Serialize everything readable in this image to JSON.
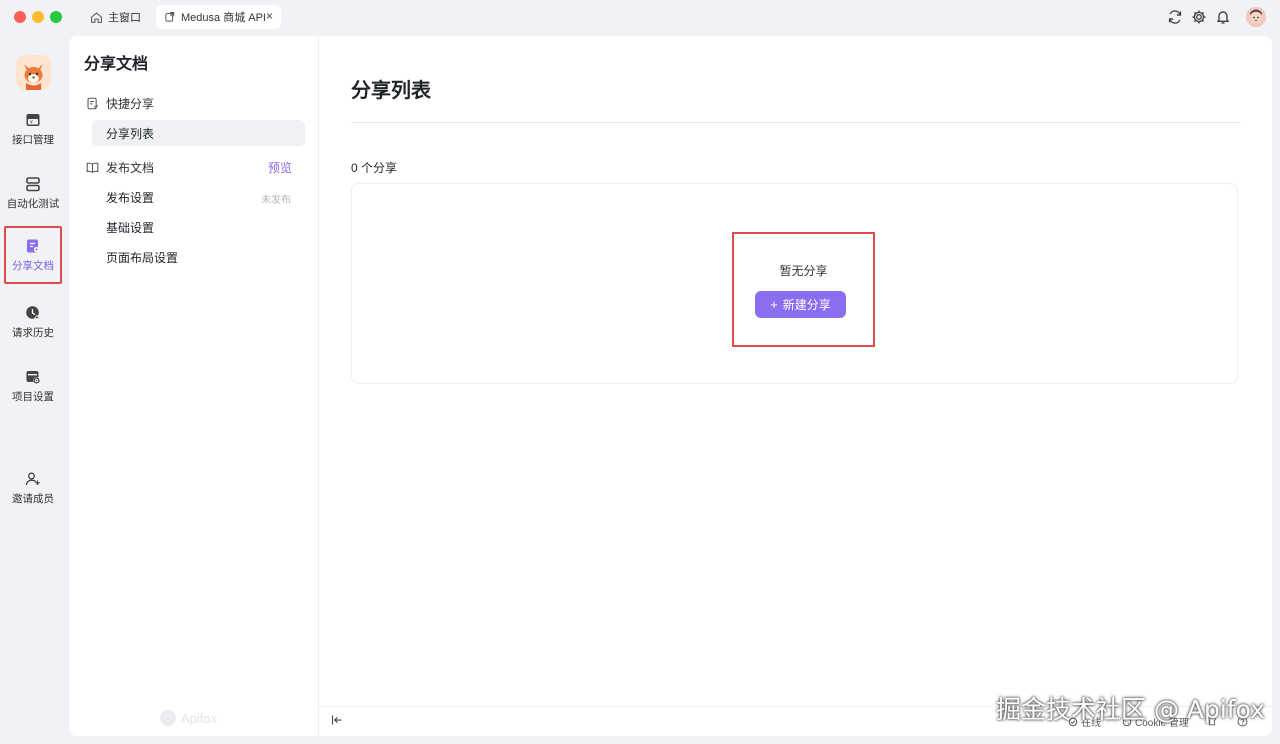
{
  "window": {
    "tabs": [
      {
        "label": "主窗口",
        "icon": "home-icon"
      },
      {
        "label": "Medusa 商城 API",
        "icon": "share-doc-icon",
        "close": "×"
      }
    ],
    "toolbar_icons": [
      "refresh-icon",
      "gear-icon",
      "bell-icon",
      "user-avatar"
    ]
  },
  "rail": {
    "items": [
      {
        "label": "接口管理",
        "icon": "api-icon"
      },
      {
        "label": "自动化测试",
        "icon": "test-icon"
      },
      {
        "label": "分享文档",
        "icon": "share-doc-icon",
        "active": true
      },
      {
        "label": "请求历史",
        "icon": "history-icon"
      },
      {
        "label": "项目设置",
        "icon": "settings-icon"
      },
      {
        "label": "邀请成员",
        "icon": "add-user-icon"
      }
    ]
  },
  "subnav": {
    "title": "分享文档",
    "quick_share": {
      "label": "快捷分享",
      "items": [
        "分享列表"
      ]
    },
    "publish": {
      "label": "发布文档",
      "preview": "预览",
      "items": [
        "发布设置",
        "基础设置",
        "页面布局设置"
      ],
      "publish_status": "未发布"
    },
    "brand": "Apifox"
  },
  "main": {
    "title": "分享列表",
    "count_text": "0 个分享",
    "empty_text": "暂无分享",
    "new_share_button": "新建分享",
    "new_share_plus": "+"
  },
  "statusbar": {
    "online": "在线",
    "cookie": "Cookie 管理"
  },
  "watermark": "掘金技术社区 @ Apifox",
  "colors": {
    "accent": "#8b6df0",
    "highlight_border": "#e14a4a",
    "background": "#f1f2f5"
  }
}
